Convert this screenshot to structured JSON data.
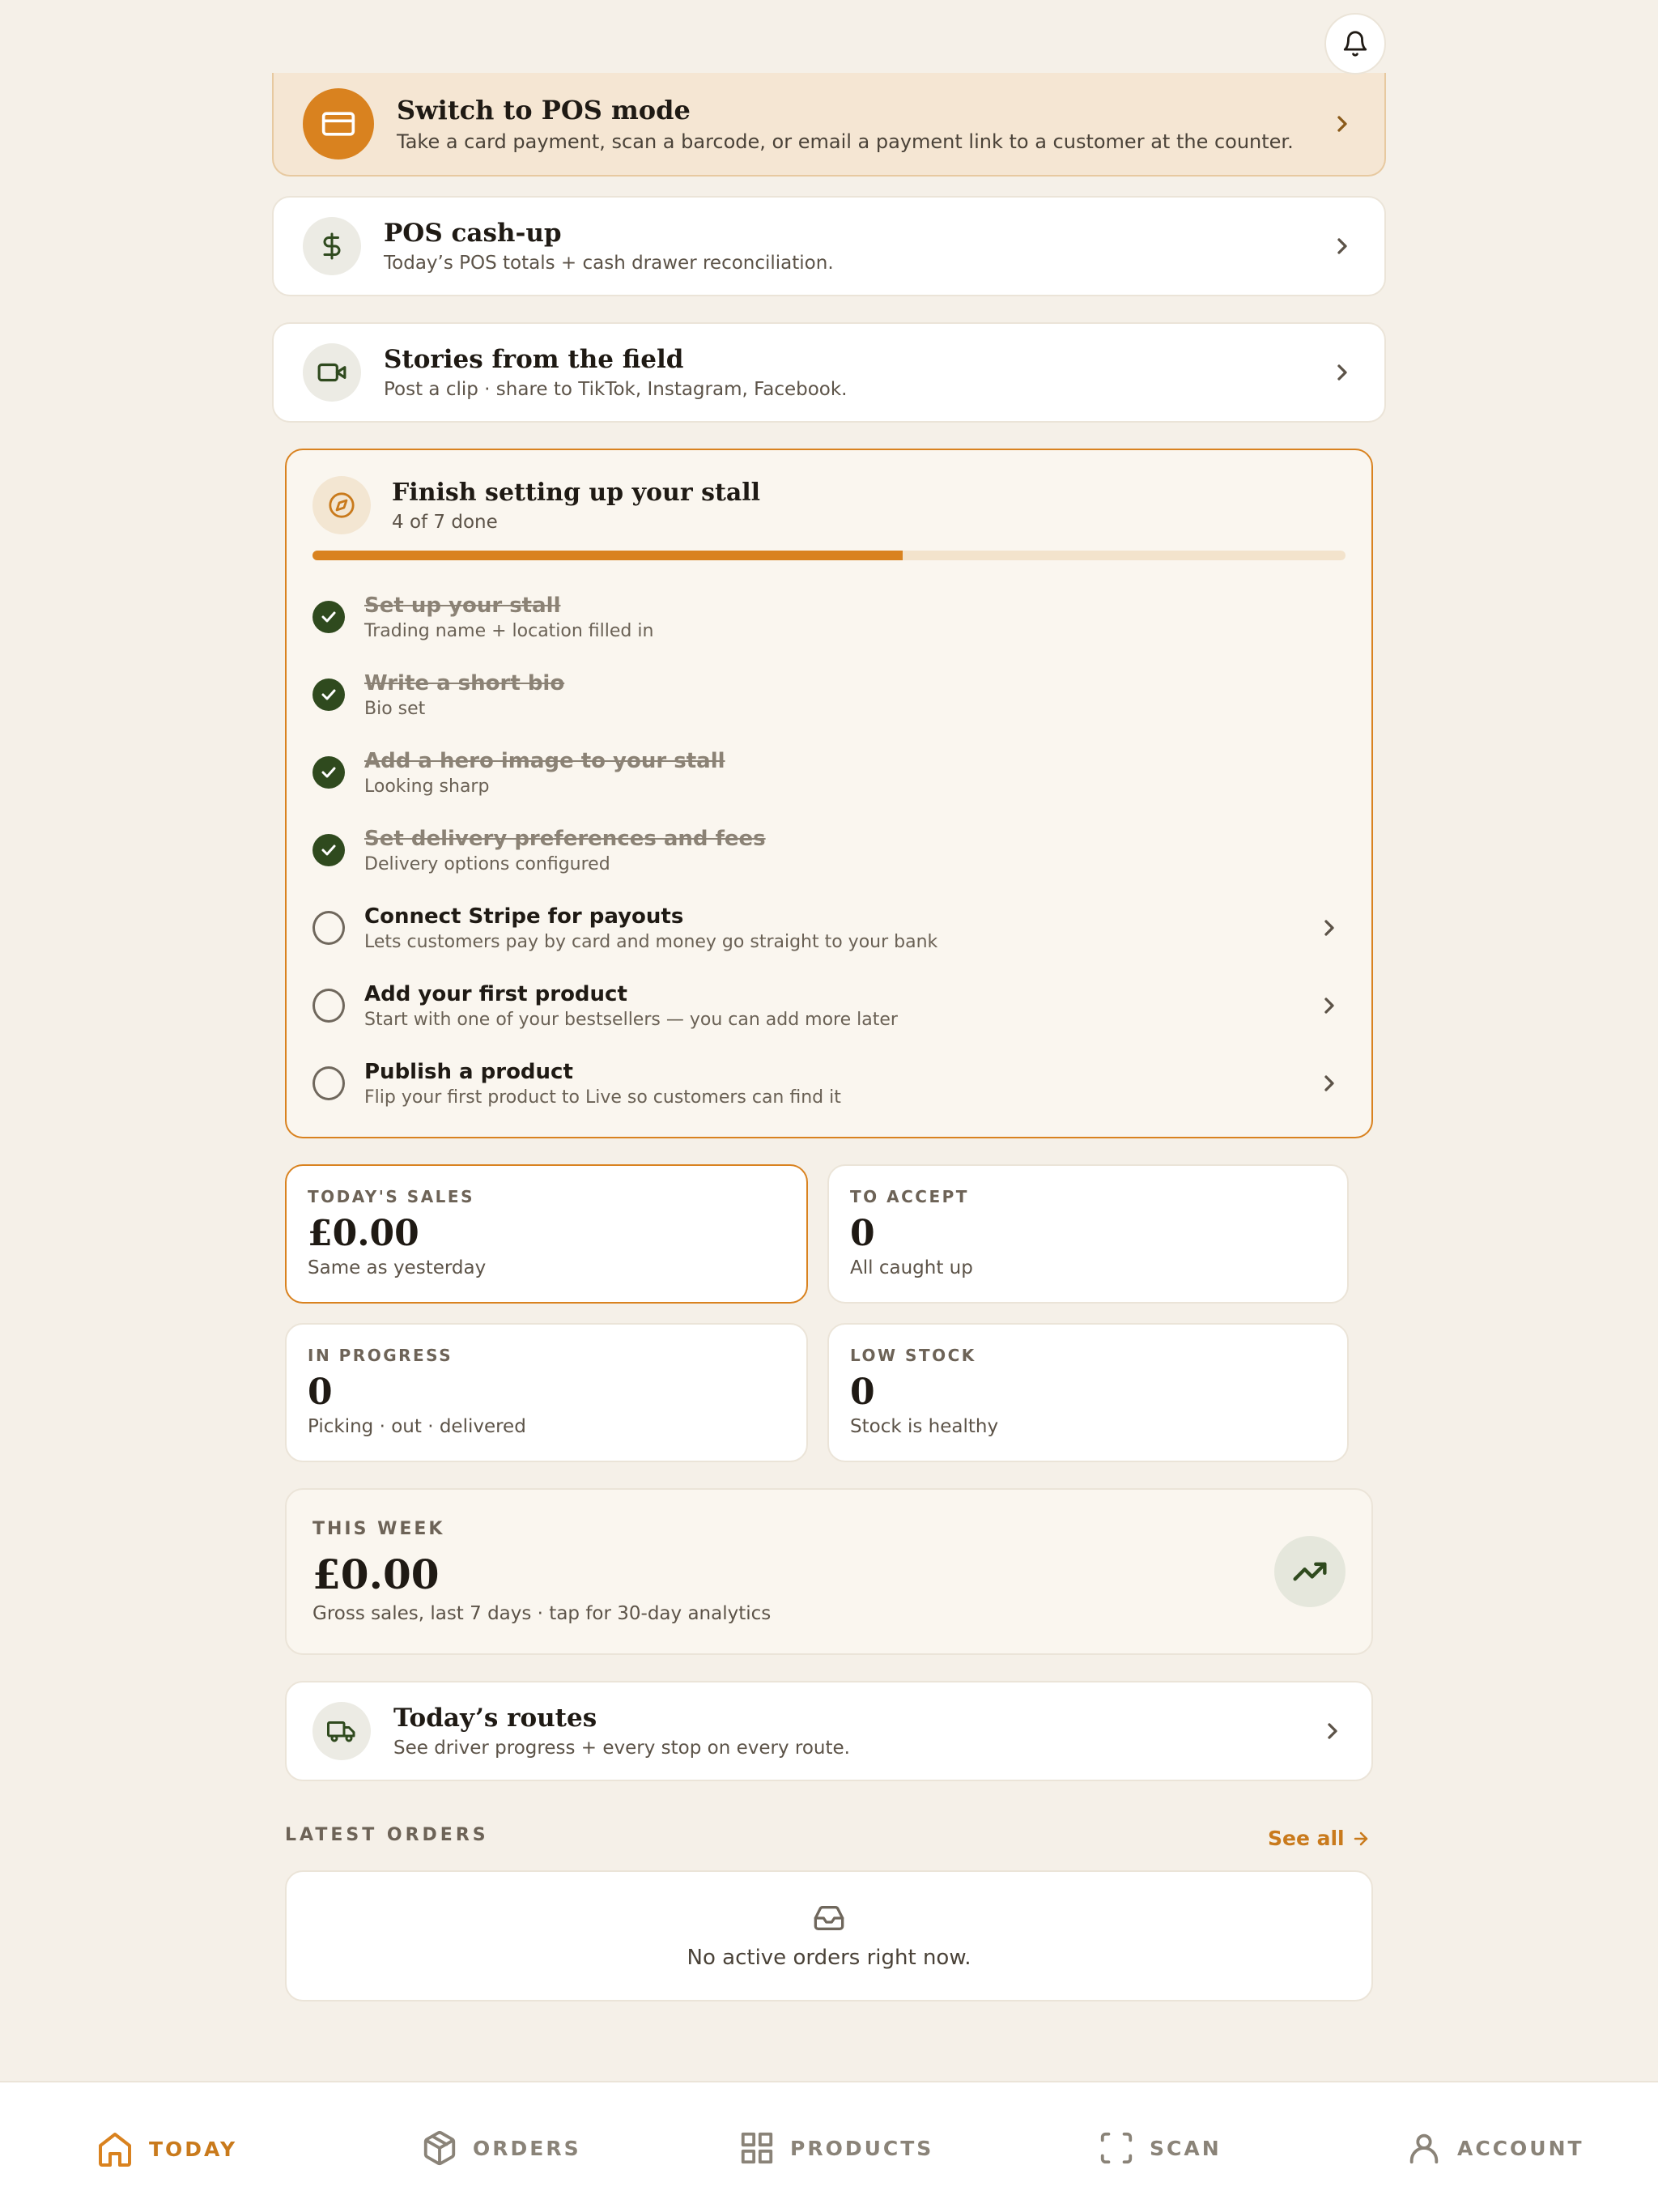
{
  "colors": {
    "accent": "#d9821f",
    "green": "#2f4a1e",
    "bg": "#f5f0e8"
  },
  "header": {
    "bell_icon": "bell-icon"
  },
  "pos_mode": {
    "title": "Switch to POS mode",
    "subtitle": "Take a card payment, scan a barcode, or email a payment link to a customer at the counter.",
    "icon": "card-icon"
  },
  "cashup": {
    "title": "POS cash-up",
    "subtitle": "Today’s POS totals + cash drawer reconciliation.",
    "icon": "dollar-icon"
  },
  "stories": {
    "title": "Stories from the field",
    "subtitle": "Post a clip · share to TikTok, Instagram, Facebook.",
    "icon": "video-icon"
  },
  "setup": {
    "title": "Finish setting up your stall",
    "progress_text": "4 of 7 done",
    "progress_fraction": 0.571,
    "tasks": [
      {
        "title": "Set up your stall",
        "subtitle": "Trading name + location filled in",
        "done": true
      },
      {
        "title": "Write a short bio",
        "subtitle": "Bio set",
        "done": true
      },
      {
        "title": "Add a hero image to your stall",
        "subtitle": "Looking sharp",
        "done": true
      },
      {
        "title": "Set delivery preferences and fees",
        "subtitle": "Delivery options configured",
        "done": true
      },
      {
        "title": "Connect Stripe for payouts",
        "subtitle": "Lets customers pay by card and money go straight to your bank",
        "done": false
      },
      {
        "title": "Add your first product",
        "subtitle": "Start with one of your bestsellers — you can add more later",
        "done": false
      },
      {
        "title": "Publish a product",
        "subtitle": "Flip your first product to Live so customers can find it",
        "done": false
      }
    ]
  },
  "stats": [
    {
      "label": "TODAY'S SALES",
      "value": "£0.00",
      "note": "Same as yesterday"
    },
    {
      "label": "TO ACCEPT",
      "value": "0",
      "note": "All caught up"
    },
    {
      "label": "IN PROGRESS",
      "value": "0",
      "note": "Picking · out · delivered"
    },
    {
      "label": "LOW STOCK",
      "value": "0",
      "note": "Stock is healthy"
    }
  ],
  "week": {
    "label": "THIS WEEK",
    "value": "£0.00",
    "note": "Gross sales, last 7 days · tap for 30-day analytics",
    "icon": "trending-up-icon"
  },
  "routes": {
    "title": "Today’s routes",
    "subtitle": "See driver progress + every stop on every route.",
    "icon": "truck-icon"
  },
  "latest": {
    "label": "LATEST ORDERS",
    "see_all": "See all",
    "empty": "No active orders right now.",
    "icon": "inbox-icon"
  },
  "nav": [
    {
      "label": "TODAY",
      "icon": "home-icon",
      "active": true
    },
    {
      "label": "ORDERS",
      "icon": "package-icon",
      "active": false
    },
    {
      "label": "PRODUCTS",
      "icon": "grid-icon",
      "active": false
    },
    {
      "label": "SCAN",
      "icon": "scan-icon",
      "active": false
    },
    {
      "label": "ACCOUNT",
      "icon": "user-icon",
      "active": false
    }
  ]
}
